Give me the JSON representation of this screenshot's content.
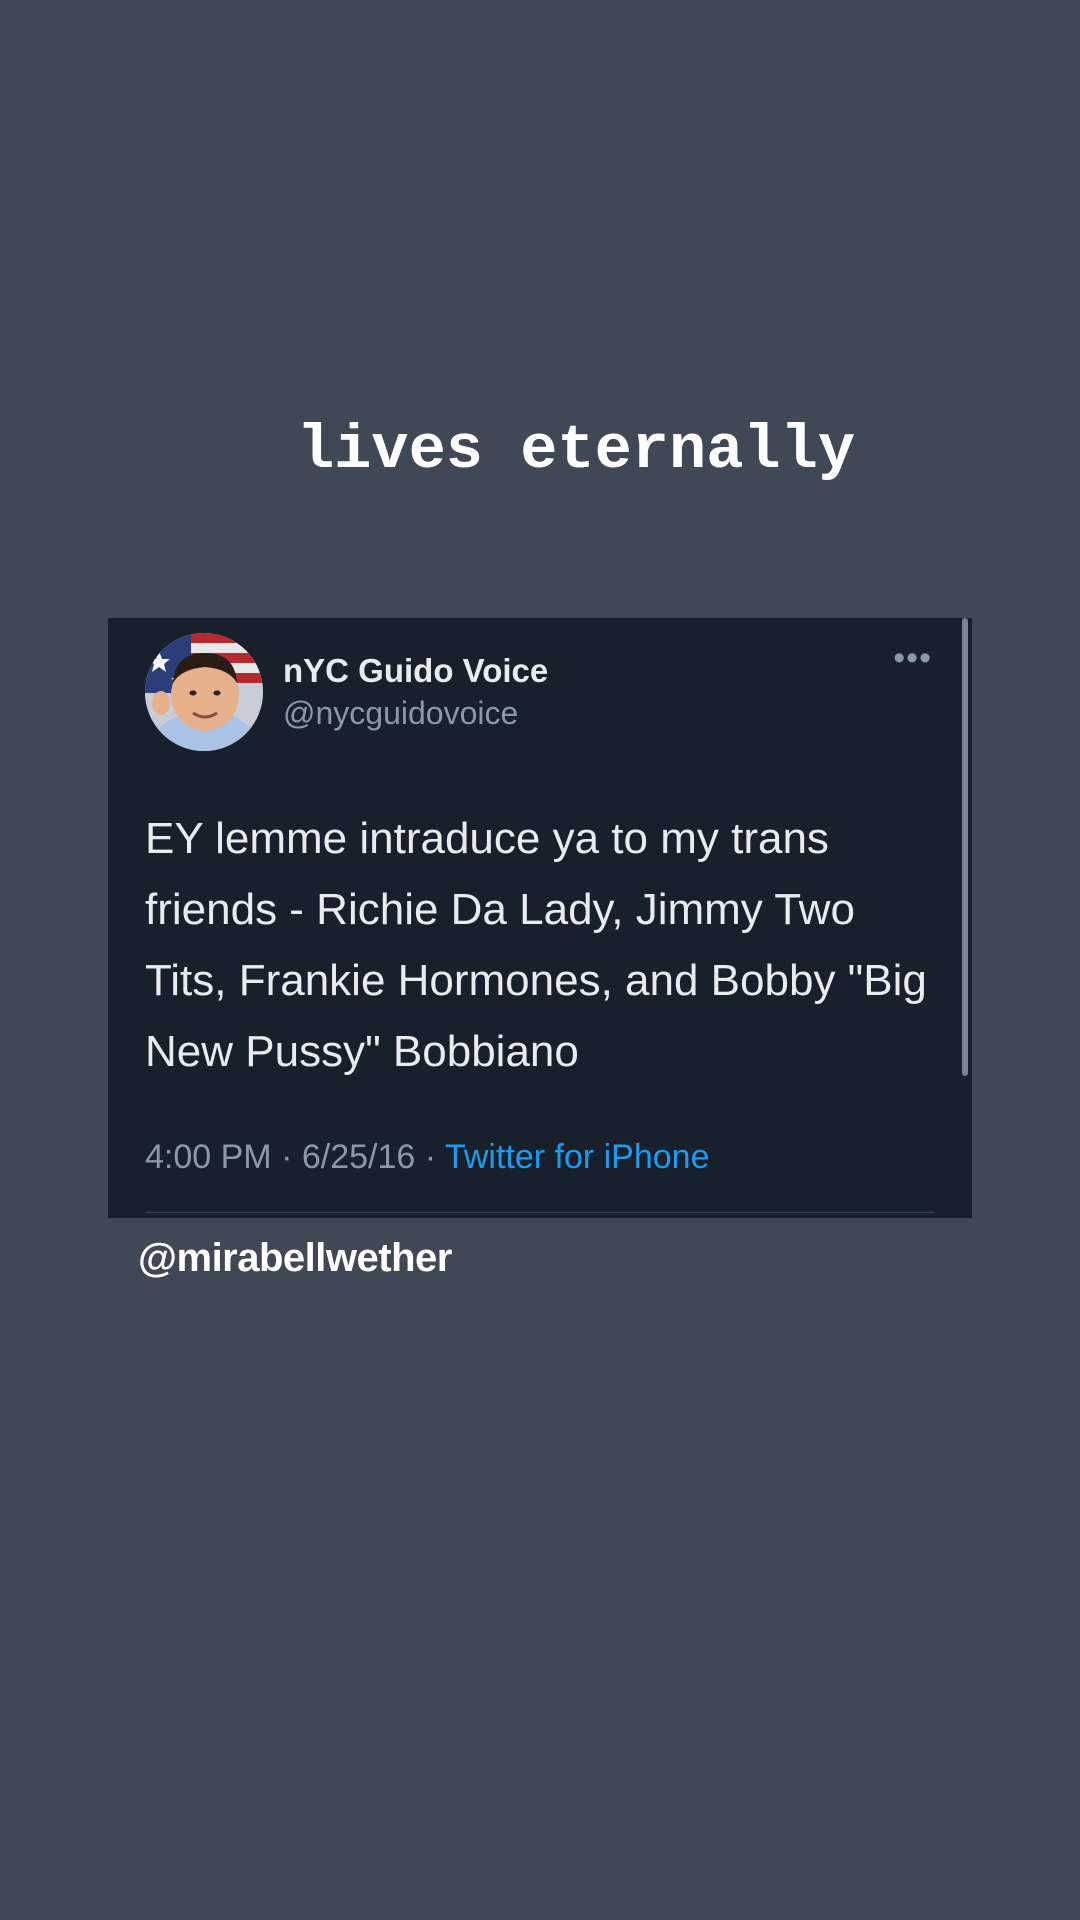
{
  "caption": "lives eternally",
  "tweet": {
    "display_name": "nYC Guido Voice",
    "handle": "@nycguidovoice",
    "text": "EY lemme intraduce ya to my trans friends - Richie Da Lady, Jimmy Two Tits, Frankie Hormones, and Bobby \"Big New Pussy\" Bobbiano",
    "time": "4:00 PM",
    "date": "6/25/16",
    "separator": "·",
    "source": "Twitter for iPhone",
    "more_icon": "more-horizontal-icon",
    "more_glyph": "•••"
  },
  "credit": "@mirabellwether",
  "colors": {
    "background": "#414855",
    "card": "#17202b",
    "primary_text": "#e9ecef",
    "secondary_text": "#8b98a5",
    "link": "#1d9bf0"
  }
}
